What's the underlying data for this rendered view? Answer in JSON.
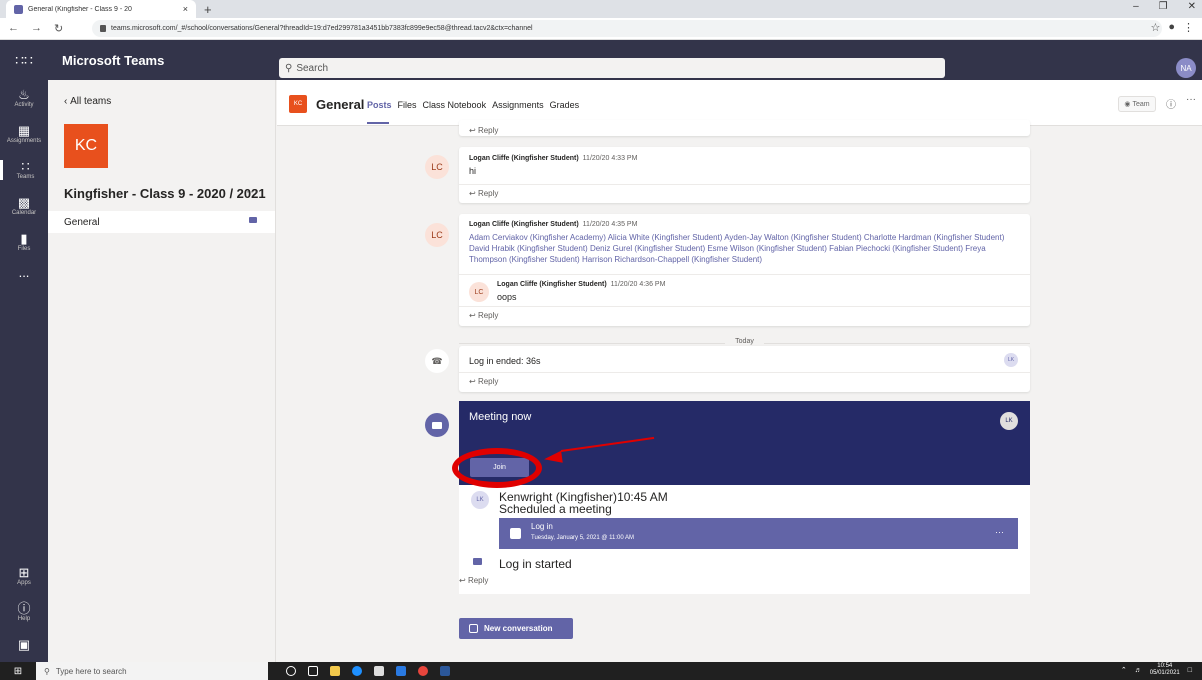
{
  "browser": {
    "tab_title": "General (Kingfisher - Class 9 - 20",
    "tab_close": "×",
    "new_tab": "+",
    "url": "teams.microsoft.com/_#/school/conversations/General?threadId=19:d7ed299781a3451bb7383fc899e9ec58@thread.tacv2&ctx=channel"
  },
  "teams": {
    "app_name": "Microsoft Teams",
    "search_placeholder": "Search",
    "user_initials": "NA"
  },
  "rail": [
    {
      "label": "Activity",
      "icon": "bell-icon"
    },
    {
      "label": "Assignments",
      "icon": "assignments-icon"
    },
    {
      "label": "Teams",
      "icon": "teams-icon"
    },
    {
      "label": "Calendar",
      "icon": "calendar-icon"
    },
    {
      "label": "Files",
      "icon": "files-icon"
    },
    {
      "label": "...",
      "icon": "more-icon"
    },
    {
      "label": "Apps",
      "icon": "apps-icon"
    },
    {
      "label": "Help",
      "icon": "help-icon"
    }
  ],
  "team_panel": {
    "back_label": "All teams",
    "team_initials": "KC",
    "team_name": "Kingfisher - Class 9 - 2020 / 2021",
    "more": "···",
    "channel": "General"
  },
  "channel_header": {
    "logo": "KC",
    "name": "General",
    "tabs": [
      "Posts",
      "Files",
      "Class Notebook",
      "Assignments",
      "Grades"
    ],
    "team_button": "Team",
    "more": "···"
  },
  "messages": {
    "reply": "Reply",
    "msg1": {
      "initials": "LC",
      "author": "Logan Cliffe (Kingfisher Student)",
      "time": "11/20/20 4:33 PM",
      "text": "hi"
    },
    "msg2": {
      "initials": "LC",
      "author": "Logan Cliffe (Kingfisher Student)",
      "time": "11/20/20 4:35 PM",
      "mentions": "Adam Cerviakov (Kingfisher Academy) Alicia White (Kingfisher Student) Ayden-Jay Walton (Kingfisher Student) Charlotte Hardman (Kingfisher Student) David Hrabik (Kingfisher Student) Deniz Gurel (Kingfisher Student) Esme Wilson (Kingfisher Student) Fabian Piechocki (Kingfisher Student) Freya Thompson (Kingfisher Student) Harrison Richardson-Chappell (Kingfisher Student)",
      "reply_initials": "LC",
      "reply_author": "Logan Cliffe (Kingfisher Student)",
      "reply_time": "11/20/20 4:36 PM",
      "reply_text": "oops"
    },
    "day_separator": "Today",
    "login_ended": {
      "text": "Log in ended: 36s",
      "initials": "LK"
    },
    "meeting": {
      "title": "Meeting now",
      "initials": "LK",
      "join": "Join",
      "organizer_initials": "LK",
      "organizer": "Kenwright (Kingfisher)",
      "time": "10:45 AM",
      "action": "Scheduled a meeting",
      "event_title": "Log in",
      "event_date": "Tuesday, January 5, 2021 @ 11:00 AM",
      "event_more": "···",
      "started": "Log in started"
    },
    "new_conversation": "New conversation"
  },
  "taskbar": {
    "search_placeholder": "Type here to search",
    "time": "10:54",
    "date": "05/01/2021"
  },
  "colors": {
    "teams_dark": "#33344a",
    "accent": "#6264a7",
    "meeting_banner": "#252a67",
    "annotation": "#e00000",
    "team_orange": "#e8501d"
  }
}
